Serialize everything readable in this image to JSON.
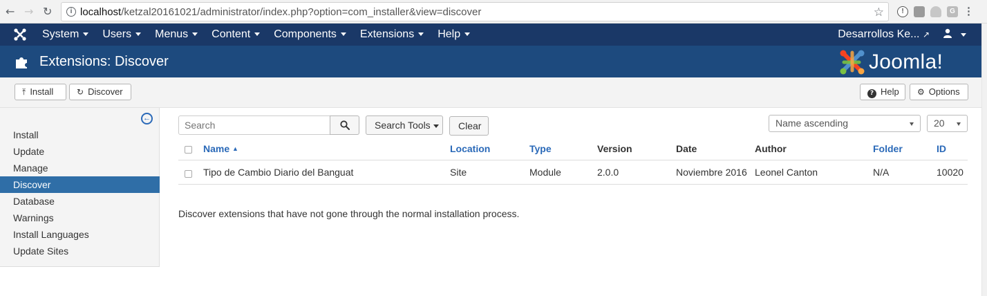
{
  "browser": {
    "url_host": "localhost",
    "url_path": "/ketzal20161021/administrator/index.php?option=com_installer&view=discover"
  },
  "topnav": {
    "menu": [
      "System",
      "Users",
      "Menus",
      "Content",
      "Components",
      "Extensions",
      "Help"
    ],
    "site_name": "Desarrollos Ke...",
    "icons": {
      "logo": "joomla-logo-icon",
      "external": "external-link-icon",
      "user": "user-icon"
    }
  },
  "titlebar": {
    "title": "Extensions: Discover",
    "brand": "Joomla!"
  },
  "toolbar": {
    "install_label": "Install",
    "discover_label": "Discover",
    "help_label": "Help",
    "options_label": "Options"
  },
  "sidebar": {
    "items": [
      {
        "label": "Install",
        "active": false
      },
      {
        "label": "Update",
        "active": false
      },
      {
        "label": "Manage",
        "active": false
      },
      {
        "label": "Discover",
        "active": true
      },
      {
        "label": "Database",
        "active": false
      },
      {
        "label": "Warnings",
        "active": false
      },
      {
        "label": "Install Languages",
        "active": false
      },
      {
        "label": "Update Sites",
        "active": false
      }
    ]
  },
  "filters": {
    "search_placeholder": "Search",
    "search_tools_label": "Search Tools",
    "clear_label": "Clear",
    "ordering": "Name ascending",
    "limit": "20"
  },
  "table": {
    "headers": {
      "name": "Name",
      "location": "Location",
      "type": "Type",
      "version": "Version",
      "date": "Date",
      "author": "Author",
      "folder": "Folder",
      "id": "ID"
    },
    "rows": [
      {
        "name": "Tipo de Cambio Diario del Banguat",
        "location": "Site",
        "type": "Module",
        "version": "2.0.0",
        "date": "Noviembre 2016",
        "author": "Leonel Canton",
        "folder": "N/A",
        "id": "10020"
      }
    ]
  },
  "footer_note": "Discover extensions that have not gone through the normal installation process.",
  "colors": {
    "topnav": "#1a3867",
    "titlebar": "#1d4a7e",
    "active": "#2f6ea7",
    "link": "#2a69b8"
  }
}
